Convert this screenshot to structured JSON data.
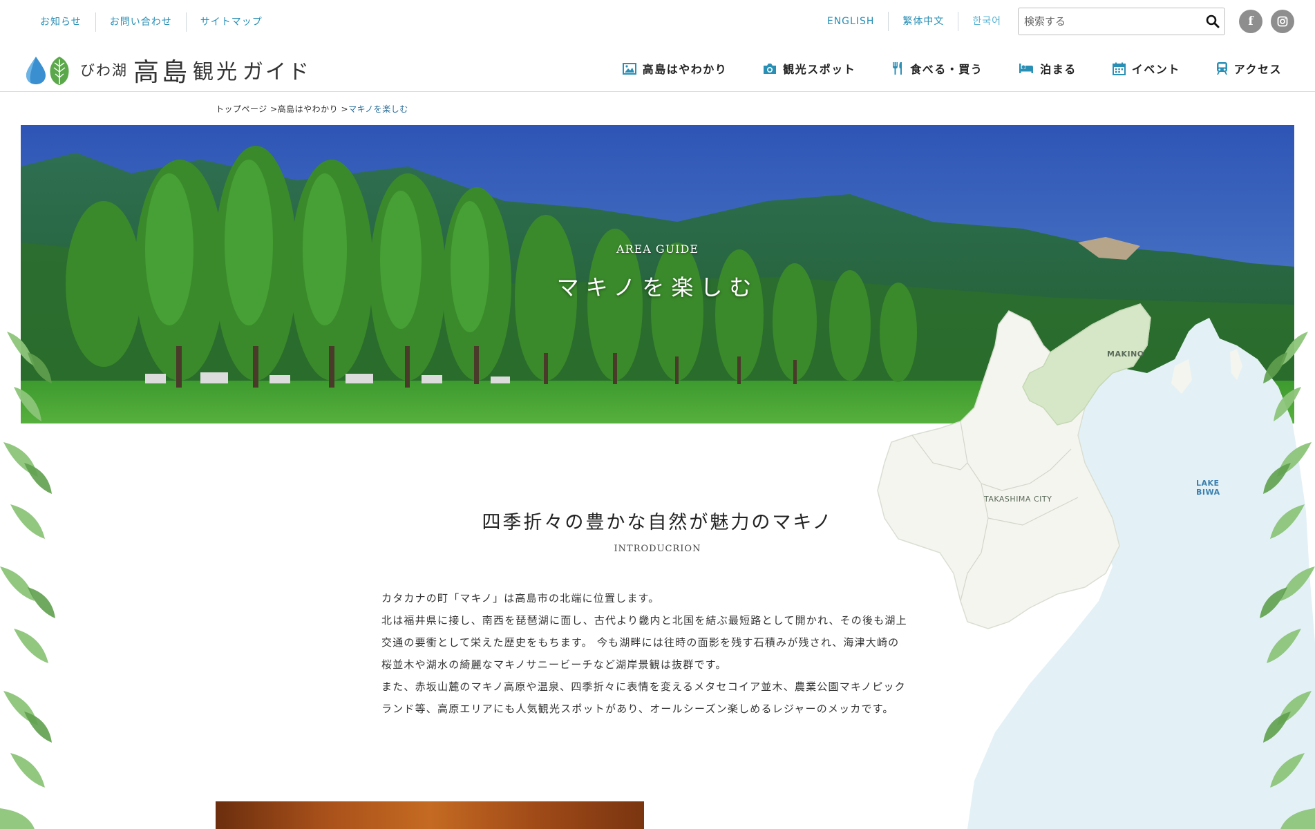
{
  "utility": {
    "links": [
      "お知らせ",
      "お問い合わせ",
      "サイトマップ"
    ],
    "languages": [
      "ENGLISH",
      "繁体中文",
      "한국어"
    ],
    "search_placeholder": "検索する"
  },
  "social": {
    "facebook": "f",
    "instagram": "◎"
  },
  "logo": {
    "sub": "びわ湖",
    "main": "高島",
    "main2": "観光",
    "guide": "ガイド"
  },
  "nav": [
    {
      "label": "高島はやわかり",
      "icon": "image-icon"
    },
    {
      "label": "観光スポット",
      "icon": "camera-icon"
    },
    {
      "label": "食べる・買う",
      "icon": "fork-knife-icon"
    },
    {
      "label": "泊まる",
      "icon": "bed-icon"
    },
    {
      "label": "イベント",
      "icon": "calendar-icon"
    },
    {
      "label": "アクセス",
      "icon": "train-icon"
    }
  ],
  "breadcrumb": {
    "home": "トップページ",
    "sep1": ">",
    "parent": "高島はやわかり",
    "sep2": ">",
    "current": "マキノを楽しむ"
  },
  "hero": {
    "label": "AREA GUIDE",
    "title": "マキノを楽しむ"
  },
  "map": {
    "makino": "MAKINO",
    "takashima": "TAKASHIMA CITY",
    "lake1": "LAKE",
    "lake2": "BIWA"
  },
  "intro": {
    "title": "四季折々の豊かな自然が魅力のマキノ",
    "subtitle": "INTRODUCRION",
    "lines": [
      "カタカナの町「マキノ」は高島市の北端に位置します。",
      "北は福井県に接し、南西を琵琶湖に面し、古代より畿内と北国を結ぶ最短路として開かれ、その後も湖上",
      "交通の要衝として栄えた歴史をもちます。 今も湖畔には往時の面影を残す石積みが残され、海津大崎の",
      "桜並木や湖水の綺麗なマキノサニービーチなど湖岸景観は抜群です。",
      "また、赤坂山麓のマキノ高原や温泉、四季折々に表情を変えるメタセコイア並木、農業公園マキノピック",
      "ランド等、高原エリアにも人気観光スポットがあり、オールシーズン楽しめるレジャーのメッカです。"
    ]
  },
  "colors": {
    "accent": "#2a8fb5",
    "logo_blue": "#3a8fd0",
    "logo_green": "#5aa84a"
  }
}
